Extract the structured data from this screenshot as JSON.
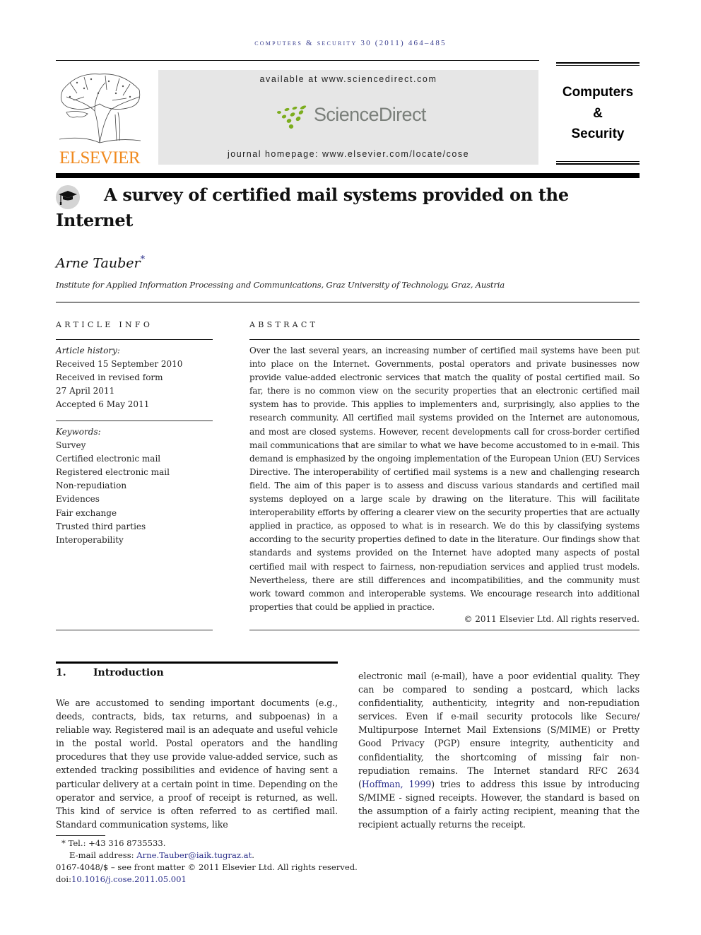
{
  "running_header": "Computers & Security 30 (2011) 464–485",
  "publisher": {
    "logo_icon": "elsevier-tree-icon",
    "name": "ELSEVIER",
    "brand_color": "#f08a1f"
  },
  "banner": {
    "available_at": "available at www.sciencedirect.com",
    "sciencedirect_logo_icon": "sciencedirect-dots-icon",
    "sciencedirect_name": "ScienceDirect",
    "sciencedirect_dot_color": "#7cad1e",
    "journal_homepage": "journal homepage: www.elsevier.com/locate/cose"
  },
  "journal_box": {
    "line1": "Computers",
    "line2": "&",
    "line3": "Security"
  },
  "article": {
    "badge_icon": "mortarboard-icon",
    "title": "A survey of certified mail systems provided on the Internet",
    "author": "Arne Tauber",
    "author_mark": "*",
    "affiliation": "Institute for Applied Information Processing and Communications, Graz University of Technology, Graz, Austria"
  },
  "article_info": {
    "heading": "ARTICLE INFO",
    "history_label": "Article history:",
    "history": [
      "Received 15 September 2010",
      "Received in revised form",
      "27 April 2011",
      "Accepted 6 May 2011"
    ],
    "keywords_label": "Keywords:",
    "keywords": [
      "Survey",
      "Certified electronic mail",
      "Registered electronic mail",
      "Non-repudiation",
      "Evidences",
      "Fair exchange",
      "Trusted third parties",
      "Interoperability"
    ]
  },
  "abstract": {
    "heading": "ABSTRACT",
    "text": "Over the last several years, an increasing number of certified mail systems have been put into place on the Internet. Governments, postal operators and private businesses now provide value-added electronic services that match the quality of postal certified mail. So far, there is no common view on the security properties that an electronic certified mail system has to provide. This applies to implementers and, surprisingly, also applies to the research community. All certified mail systems provided on the Internet are autonomous, and most are closed systems. However, recent developments call for cross-border certified mail communications that are similar to what we have become accustomed to in e-mail. This demand is emphasized by the ongoing implementation of the European Union (EU) Services Directive. The interoperability of certified mail systems is a new and challenging research field. The aim of this paper is to assess and discuss various standards and certified mail systems deployed on a large scale by drawing on the literature. This will facilitate interoperability efforts by offering a clearer view on the security properties that are actually applied in practice, as opposed to what is in research. We do this by classifying systems according to the security properties defined to date in the literature. Our findings show that standards and systems provided on the Internet have adopted many aspects of postal certified mail with respect to fairness, non-repudiation services and applied trust models. Nevertheless, there are still differences and incompatibilities, and the community must work toward common and interoperable systems. We encourage research into additional properties that could be applied in practice.",
    "copyright": "© 2011 Elsevier Ltd. All rights reserved."
  },
  "introduction": {
    "number": "1.",
    "heading": "Introduction",
    "left_text": "We are accustomed to sending important documents (e.g., deeds, contracts, bids, tax returns, and subpoenas) in a reliable way. Registered mail is an adequate and useful vehicle in the postal world. Postal operators and the handling procedures that they use provide value-added service, such as extended tracking possibilities and evidence of having sent a particular delivery at a certain point in time. Depending on the operator and service, a proof of receipt is returned, as well. This kind of service is often referred to as certified mail. Standard communication systems, like",
    "right_text_before_ref": "electronic mail (e-mail), have a poor evidential quality. They can be compared to sending a postcard, which lacks confidentiality, authenticity, integrity and non-repudiation services. Even if e-mail security protocols like Secure/ Multipurpose Internet Mail Extensions (S/MIME) or Pretty Good Privacy (PGP) ensure integrity, authenticity and confidentiality, the shortcoming of missing fair non-repudiation remains. The Internet standard RFC 2634 (",
    "citation": "Hoffman, 1999",
    "right_text_after_ref": ") tries to address this issue by introducing S/MIME - signed receipts. However, the standard is based on the assumption of a fairly acting recipient, meaning that the recipient actually returns the receipt."
  },
  "footnotes": {
    "mark": "*",
    "tel": "Tel.: +43 316 8735533.",
    "email_label": "E-mail address: ",
    "email": "Arne.Tauber@iaik.tugraz.at",
    "email_end": ".",
    "front_matter": "0167-4048/$ – see front matter © 2011 Elsevier Ltd. All rights reserved.",
    "doi_label": "doi:",
    "doi": "10.1016/j.cose.2011.05.001"
  },
  "colors": {
    "link": "#2b2f8a",
    "running_header": "#3a3f8f",
    "banner_bg": "#e6e6e6"
  }
}
